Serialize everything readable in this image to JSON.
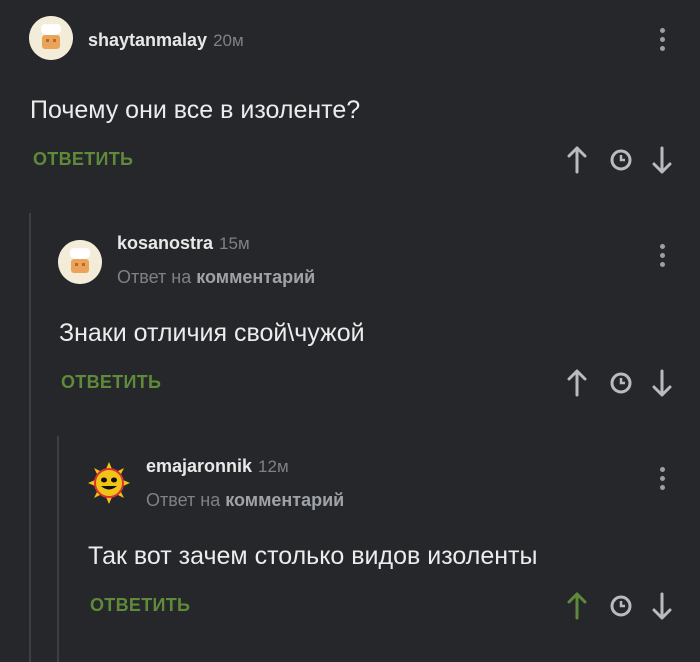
{
  "comments": [
    {
      "author": "shaytanmalay",
      "time": "20м",
      "text": "Почему они все в изоленте?",
      "reply_label": "ОТВЕТИТЬ",
      "upvote_color": "#b8bcc0"
    },
    {
      "author": "kosanostra",
      "time": "15м",
      "reply_prefix": "Ответ на",
      "reply_target": "комментарий",
      "text": "Знаки отличия свой\\чужой",
      "reply_label": "ОТВЕТИТЬ",
      "upvote_color": "#b8bcc0"
    },
    {
      "author": "emajaronnik",
      "time": "12м",
      "reply_prefix": "Ответ на",
      "reply_target": "комментарий",
      "text": "Так вот зачем столько видов изоленты",
      "reply_label": "ОТВЕТИТЬ",
      "upvote_color": "#5e8a3a"
    }
  ],
  "colors": {
    "background": "#25272a",
    "accent_green": "#5e8a3a",
    "muted_text": "#7d8287"
  }
}
